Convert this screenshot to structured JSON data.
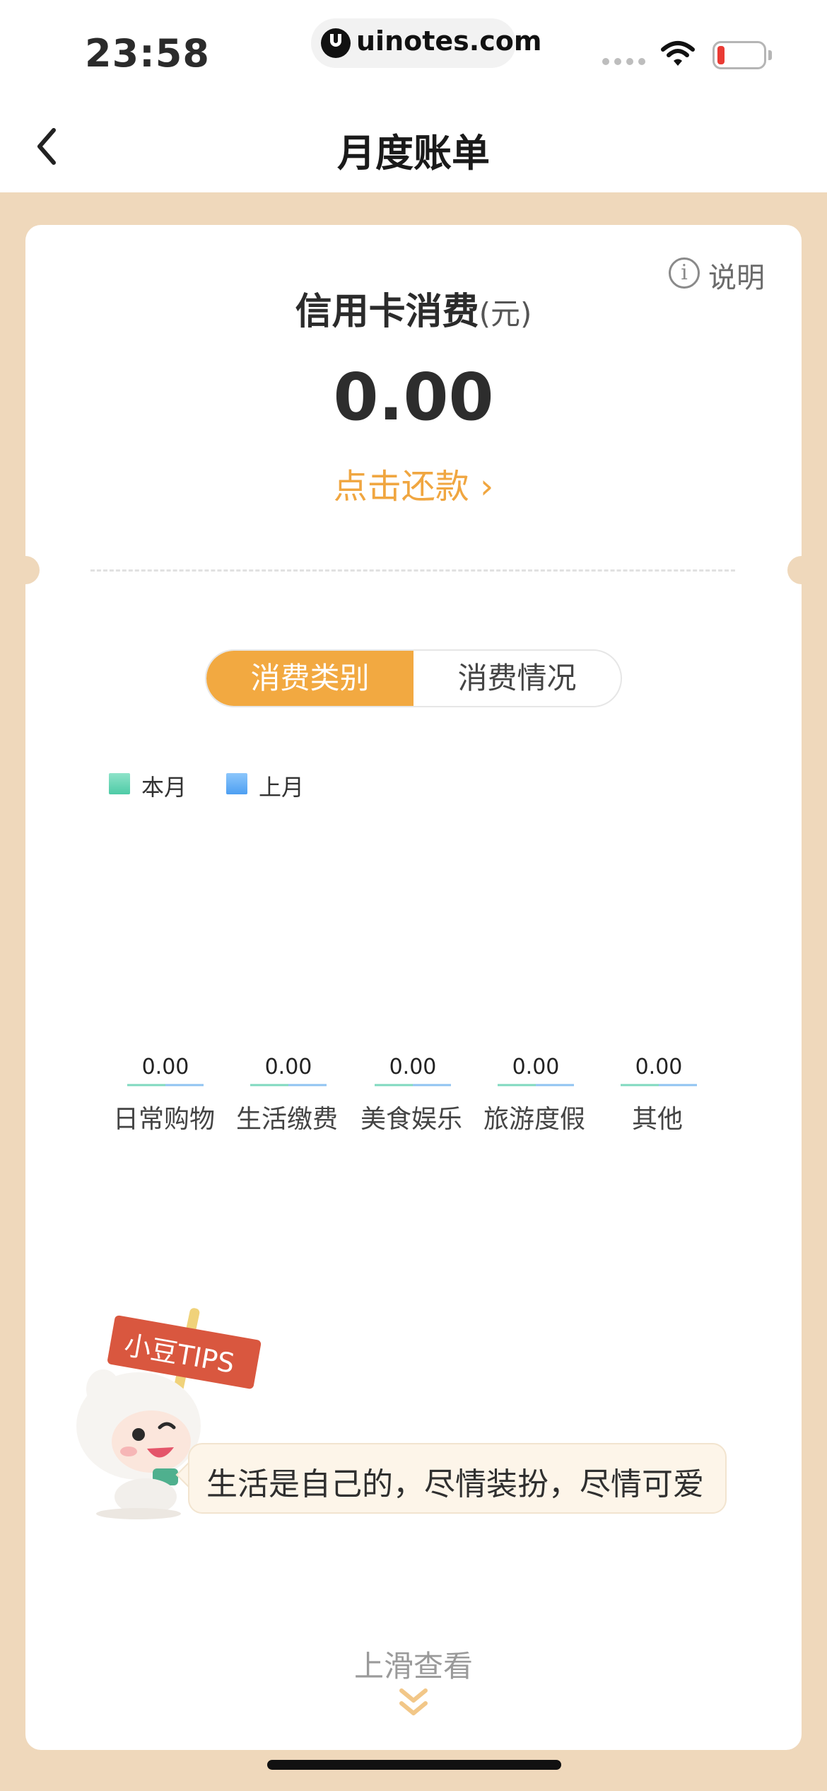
{
  "status_bar": {
    "time": "23:58",
    "url": "uinotes.com"
  },
  "nav": {
    "title": "月度账单"
  },
  "summary": {
    "help_label": "说明",
    "title": "信用卡消费",
    "unit": "(元)",
    "amount": "0.00",
    "repay_link": "点击还款 ›"
  },
  "tabs": [
    {
      "label": "消费类别",
      "active": true
    },
    {
      "label": "消费情况",
      "active": false
    }
  ],
  "chart_data": {
    "type": "bar",
    "categories": [
      "日常购物",
      "生活缴费",
      "美食娱乐",
      "旅游度假",
      "其他"
    ],
    "series": [
      {
        "name": "本月",
        "color": "#5fd0b0",
        "values": [
          0.0,
          0.0,
          0.0,
          0.0,
          0.0
        ]
      },
      {
        "name": "上月",
        "color": "#5aa8f5",
        "values": [
          0.0,
          0.0,
          0.0,
          0.0,
          0.0
        ]
      }
    ],
    "value_labels": [
      "0.00",
      "0.00",
      "0.00",
      "0.00",
      "0.00"
    ],
    "legend_position": "top-left",
    "grid": false
  },
  "tips": {
    "sign_text": "小豆TIPS",
    "message": "生活是自己的，尽情装扮，尽情可爱"
  },
  "footer": {
    "swipe_label": "上滑查看"
  },
  "colors": {
    "accent": "#f2a941",
    "background": "#efd8bb"
  }
}
